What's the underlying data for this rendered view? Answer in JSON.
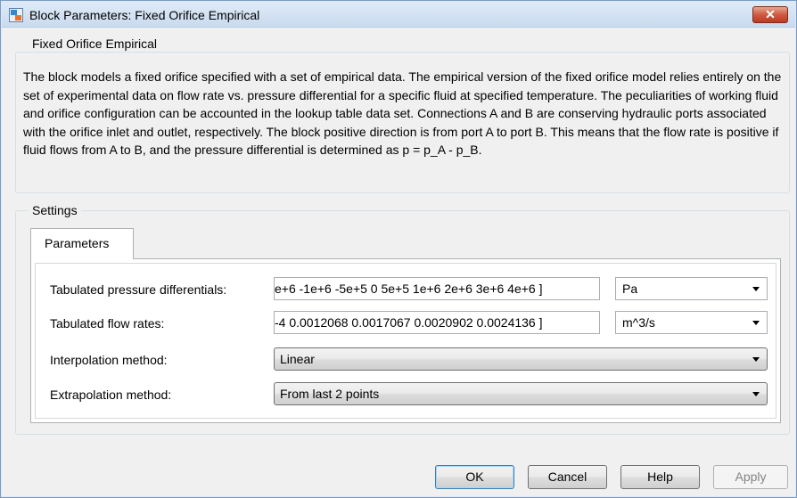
{
  "window": {
    "title": "Block Parameters: Fixed Orifice Empirical",
    "close_glyph": "✕",
    "app_icon": "simulink-block-icon"
  },
  "description": {
    "group_title": "Fixed Orifice Empirical",
    "text": "The block models a fixed orifice specified with a set of empirical data. The empirical version of the fixed orifice model relies entirely on the set of experimental data on flow rate vs. pressure differential for a specific fluid at specified temperature. The peculiarities of working fluid and orifice configuration can be accounted in the lookup table data set. Connections A and B are conserving hydraulic ports associated with the orifice inlet and outlet, respectively. The block positive direction is from port A to port B. This means that the flow rate is positive if fluid flows from A to B, and the pressure differential is determined as p = p_A - p_B."
  },
  "settings": {
    "group_title": "Settings",
    "tabs": [
      {
        "label": "Parameters",
        "active": true
      }
    ],
    "params": {
      "pressure": {
        "label": "Tabulated pressure differentials:",
        "value": "e+6 -1e+6 -5e+5 0 5e+5 1e+6 2e+6 3e+6 4e+6 ]",
        "unit": "Pa"
      },
      "flow": {
        "label": "Tabulated flow rates:",
        "value": "-4 0.0012068 0.0017067 0.0020902 0.0024136 ]",
        "unit": "m^3/s"
      },
      "interpolation": {
        "label": "Interpolation method:",
        "value": "Linear"
      },
      "extrapolation": {
        "label": "Extrapolation method:",
        "value": "From last 2 points"
      }
    }
  },
  "buttons": {
    "ok": "OK",
    "cancel": "Cancel",
    "help": "Help",
    "apply": "Apply"
  },
  "colors": {
    "title_bar": "#c9dbef",
    "close_button": "#c94a31",
    "default_button_border": "#3c7fb1",
    "disabled_text": "#838383"
  }
}
